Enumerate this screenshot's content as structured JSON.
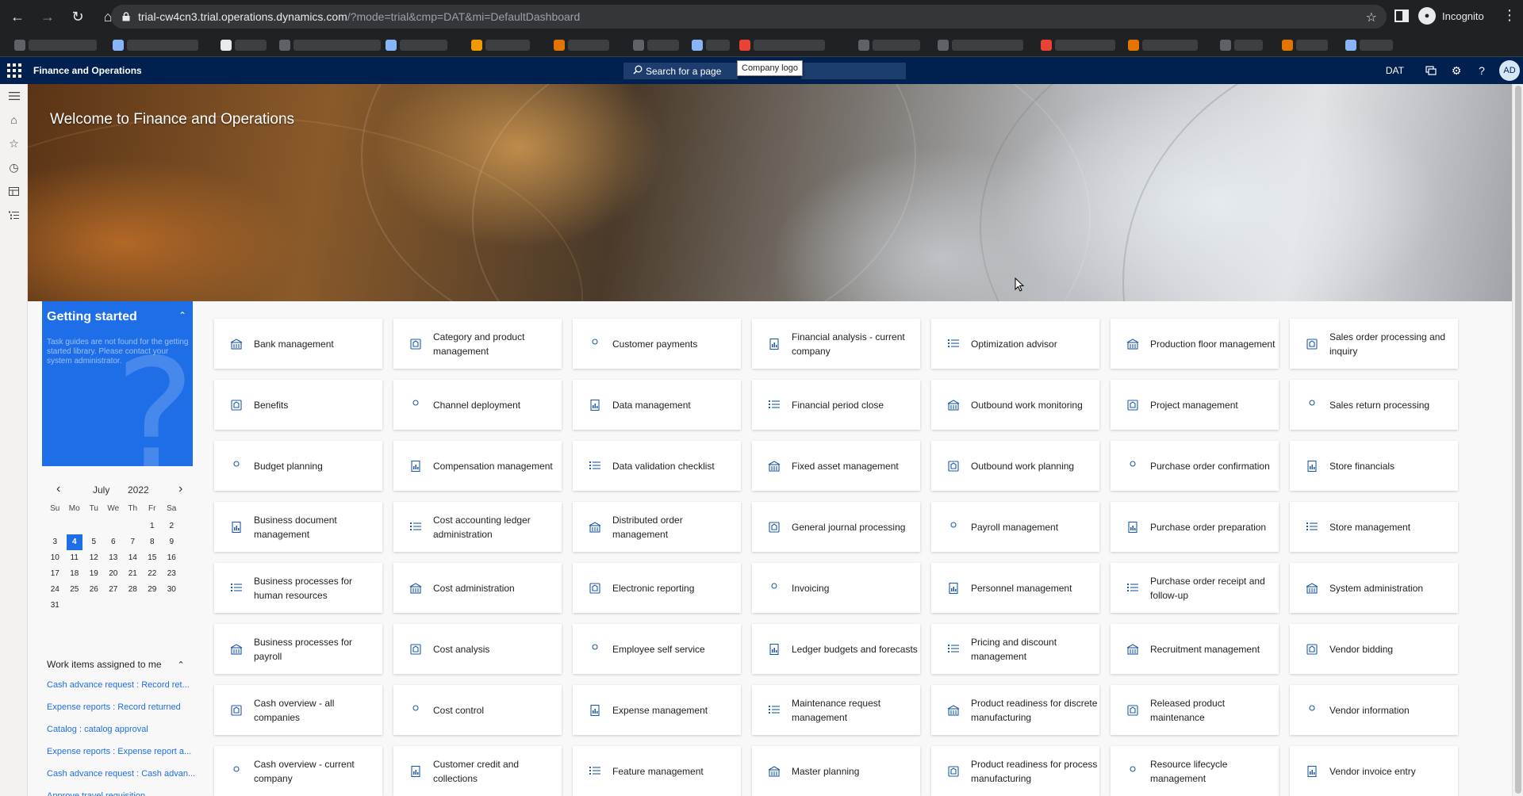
{
  "browser": {
    "url_host": "trial-cw4cn3.trial.operations.dynamics.com",
    "url_path": "/?mode=trial&cmp=DAT&mi=DefaultDashboard",
    "profile_label": "Incognito"
  },
  "header": {
    "app_title": "Finance and Operations",
    "search_label": "Search for a page",
    "tooltip": "Company logo",
    "company": "DAT",
    "user_initials": "AD"
  },
  "hero": {
    "title": "Welcome to Finance and Operations"
  },
  "getting_started": {
    "title": "Getting started",
    "message": "Task guides are not found for the getting started library. Please contact your system administrator."
  },
  "calendar": {
    "month": "July",
    "year": "2022",
    "weekdays": [
      "Su",
      "Mo",
      "Tu",
      "We",
      "Th",
      "Fr",
      "Sa"
    ],
    "days": [
      "",
      "",
      "",
      "",
      "",
      "1",
      "2",
      "3",
      "4",
      "5",
      "6",
      "7",
      "8",
      "9",
      "10",
      "11",
      "12",
      "13",
      "14",
      "15",
      "16",
      "17",
      "18",
      "19",
      "20",
      "21",
      "22",
      "23",
      "24",
      "25",
      "26",
      "27",
      "28",
      "29",
      "30",
      "31"
    ],
    "today": "4"
  },
  "work_items": {
    "title": "Work items assigned to me",
    "items": [
      "Cash advance request : Record ret...",
      "Expense reports : Record returned",
      "Catalog : catalog approval",
      "Expense reports : Expense report a...",
      "Cash advance request : Cash advan...",
      "Approve travel requisition"
    ]
  },
  "tiles": [
    [
      "Bank management",
      "Category and product management",
      "Customer payments",
      "Financial analysis - current company",
      "Optimization advisor",
      "Production floor management",
      "Sales order processing and inquiry"
    ],
    [
      "Benefits",
      "Channel deployment",
      "Data management",
      "Financial period close",
      "Outbound work monitoring",
      "Project management",
      "Sales return processing"
    ],
    [
      "Budget planning",
      "Compensation management",
      "Data validation checklist",
      "Fixed asset management",
      "Outbound work planning",
      "Purchase order confirmation",
      "Store financials"
    ],
    [
      "Business document management",
      "Cost accounting ledger administration",
      "Distributed order management",
      "General journal processing",
      "Payroll management",
      "Purchase order preparation",
      "Store management"
    ],
    [
      "Business processes for human resources",
      "Cost administration",
      "Electronic reporting",
      "Invoicing",
      "Personnel management",
      "Purchase order receipt and follow-up",
      "System administration"
    ],
    [
      "Business processes for payroll",
      "Cost analysis",
      "Employee self service",
      "Ledger budgets and forecasts",
      "Pricing and discount management",
      "Recruitment management",
      "Vendor bidding"
    ],
    [
      "Cash overview - all companies",
      "Cost control",
      "Expense management",
      "Maintenance request management",
      "Product readiness for discrete manufacturing",
      "Released product maintenance",
      "Vendor information"
    ],
    [
      "Cash overview - current company",
      "Customer credit and collections",
      "Feature management",
      "Master planning",
      "Product readiness for process manufacturing",
      "Resource lifecycle management",
      "Vendor invoice entry"
    ]
  ],
  "colors": {
    "header_bg": "#002050",
    "accent": "#1e6ee8",
    "tile_icon": "#1e5aa8"
  }
}
